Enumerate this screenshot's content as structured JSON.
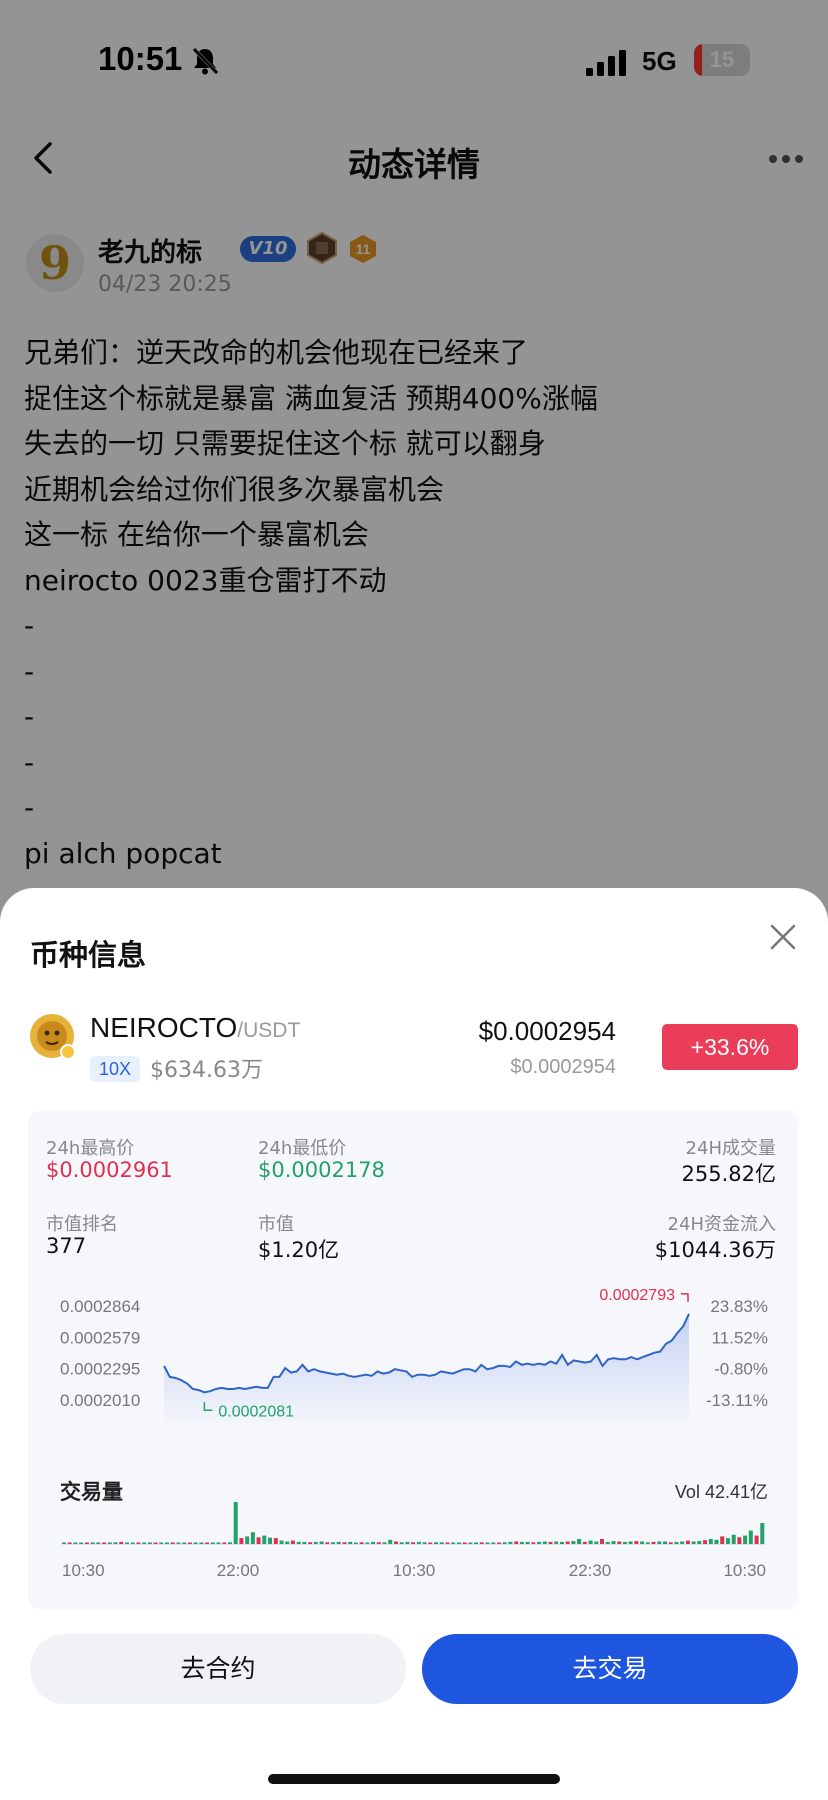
{
  "status_bar": {
    "time": "10:51",
    "network": "5G",
    "battery": "15",
    "battery_level": 0.15
  },
  "nav": {
    "title": "动态详情"
  },
  "post": {
    "author": "老九的标",
    "vip": "V10",
    "level": "11",
    "time": "04/23 20:25",
    "lines": [
      "兄弟们：逆天改命的机会他现在已经来了",
      "捉住这个标就是暴富 满血复活 预期400%涨幅",
      "失去的一切 只需要捉住这个标 就可以翻身",
      "近期机会给过你们很多次暴富机会",
      "这一标 在给你一个暴富机会",
      "neirocto 0023重仓雷打不动",
      "-",
      "-",
      "-",
      "-",
      "-",
      "pi alch popcat"
    ]
  },
  "sheet": {
    "title": "币种信息",
    "coin": {
      "symbol": "NEIROCTO",
      "quote": "/USDT",
      "leverage": "10X",
      "turnover": "$634.63万",
      "price": "$0.0002954",
      "price_sub": "$0.0002954",
      "change": "+33.6%"
    },
    "stats": {
      "high_label": "24h最高价",
      "high_value": "$0.0002961",
      "low_label": "24h最低价",
      "low_value": "$0.0002178",
      "volume_label": "24H成交量",
      "volume_value": "255.82亿",
      "rank_label": "市值排名",
      "rank_value": "377",
      "mcap_label": "市值",
      "mcap_value": "$1.20亿",
      "inflow_label": "24H资金流入",
      "inflow_value": "$1044.36万"
    },
    "volume_title": "交易量",
    "volume_total": "Vol 42.41亿",
    "buttons": {
      "contract": "去合约",
      "trade": "去交易"
    }
  },
  "colors": {
    "up": "#e0304f",
    "down": "#22a16b",
    "line": "#2f64c8",
    "accent": "#1f56e0"
  },
  "chart_data": [
    {
      "type": "line",
      "y_ticks_left": [
        "0.0002864",
        "0.0002579",
        "0.0002295",
        "0.0002010"
      ],
      "y_ticks_right": [
        "23.83%",
        "11.52%",
        "-0.80%",
        "-13.11%"
      ],
      "ylim": [
        0.000201,
        0.0002864
      ],
      "max_label": "0.0002793",
      "min_label": "0.0002081",
      "values": [
        0.000232,
        0.000222,
        0.000221,
        0.000219,
        0.000216,
        0.000211,
        0.00021,
        0.000208,
        0.000209,
        0.000211,
        0.000212,
        0.000211,
        0.000211,
        0.000212,
        0.000211,
        0.000212,
        0.000213,
        0.000212,
        0.000212,
        0.000222,
        0.000222,
        0.00023,
        0.000226,
        0.000227,
        0.000233,
        0.000227,
        0.000229,
        0.000227,
        0.000226,
        0.000225,
        0.000224,
        0.000225,
        0.000223,
        0.000222,
        0.000223,
        0.000224,
        0.000223,
        0.000227,
        0.000225,
        0.000226,
        0.000229,
        0.000228,
        0.000227,
        0.000222,
        0.000224,
        0.000224,
        0.000223,
        0.000224,
        0.000227,
        0.000226,
        0.000225,
        0.000227,
        0.000229,
        0.000229,
        0.000227,
        0.000233,
        0.000229,
        0.00023,
        0.000232,
        0.000232,
        0.000231,
        0.000236,
        0.000233,
        0.000234,
        0.000233,
        0.000234,
        0.000233,
        0.000236,
        0.000234,
        0.000242,
        0.000233,
        0.000237,
        0.000236,
        0.000235,
        0.000236,
        0.000242,
        0.000232,
        0.000238,
        0.000239,
        0.000238,
        0.000238,
        0.00024,
        0.000238,
        0.00024,
        0.000242,
        0.000244,
        0.000245,
        0.000252,
        0.000255,
        0.000262,
        0.000268,
        0.0002793
      ]
    },
    {
      "type": "bar",
      "title": "交易量",
      "total": "Vol 42.41亿",
      "x_ticks": [
        "10:30",
        "22:00",
        "10:30",
        "22:30",
        "10:30"
      ],
      "values": [
        0.02,
        0.03,
        0.02,
        0.02,
        0.03,
        0.03,
        0.02,
        0.02,
        0.03,
        0.04,
        0.05,
        0.03,
        0.03,
        0.02,
        0.02,
        0.03,
        0.02,
        0.03,
        0.02,
        0.02,
        0.02,
        0.03,
        0.02,
        0.02,
        0.03,
        0.03,
        0.02,
        0.02,
        0.02,
        0.04,
        1.0,
        0.14,
        0.18,
        0.28,
        0.16,
        0.2,
        0.15,
        0.14,
        0.08,
        0.06,
        0.08,
        0.05,
        0.05,
        0.04,
        0.05,
        0.06,
        0.04,
        0.04,
        0.05,
        0.04,
        0.05,
        0.03,
        0.04,
        0.03,
        0.05,
        0.04,
        0.04,
        0.1,
        0.06,
        0.04,
        0.05,
        0.04,
        0.05,
        0.04,
        0.03,
        0.04,
        0.04,
        0.03,
        0.03,
        0.03,
        0.03,
        0.03,
        0.03,
        0.04,
        0.03,
        0.03,
        0.02,
        0.04,
        0.05,
        0.06,
        0.05,
        0.05,
        0.04,
        0.05,
        0.06,
        0.05,
        0.06,
        0.05,
        0.06,
        0.07,
        0.12,
        0.05,
        0.08,
        0.06,
        0.12,
        0.05,
        0.07,
        0.06,
        0.05,
        0.06,
        0.07,
        0.06,
        0.04,
        0.05,
        0.06,
        0.06,
        0.04,
        0.05,
        0.06,
        0.08,
        0.06,
        0.07,
        0.09,
        0.12,
        0.1,
        0.18,
        0.14,
        0.22,
        0.16,
        0.2,
        0.32,
        0.2,
        0.5
      ]
    }
  ]
}
